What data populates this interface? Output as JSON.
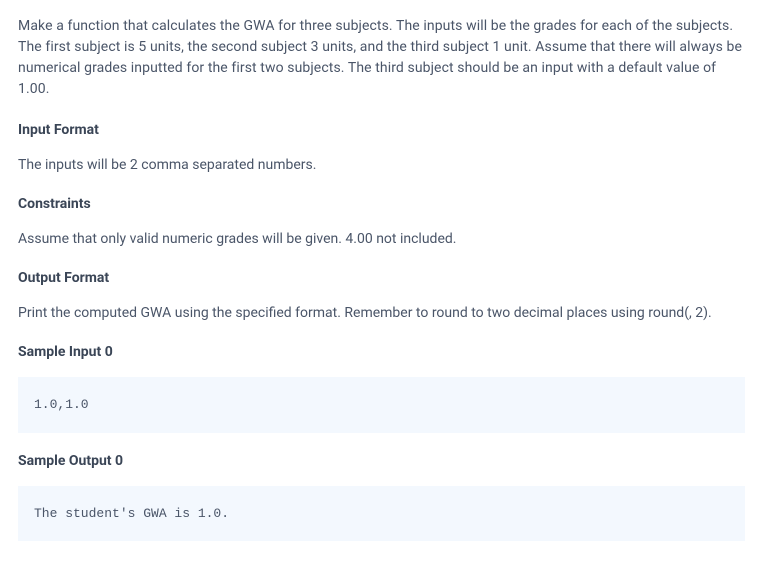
{
  "description": "Make a function that calculates the GWA for three subjects. The inputs will be the grades for each of the subjects. The first subject is 5 units, the second subject 3 units, and the third subject 1 unit. Assume that there will always be numerical grades inputted for the first two subjects. The third subject should be an input with a default value of 1.00.",
  "sections": {
    "input_format": {
      "heading": "Input Format",
      "text": "The inputs will be 2 comma separated numbers."
    },
    "constraints": {
      "heading": "Constraints",
      "text": "Assume that only valid numeric grades will be given. 4.00 not included."
    },
    "output_format": {
      "heading": "Output Format",
      "text": "Print the computed GWA using the specified format. Remember to round to two decimal places using round(, 2)."
    },
    "sample_input_0": {
      "heading": "Sample Input 0",
      "code": "1.0,1.0"
    },
    "sample_output_0": {
      "heading": "Sample Output 0",
      "code": "The student's GWA is 1.0."
    }
  }
}
